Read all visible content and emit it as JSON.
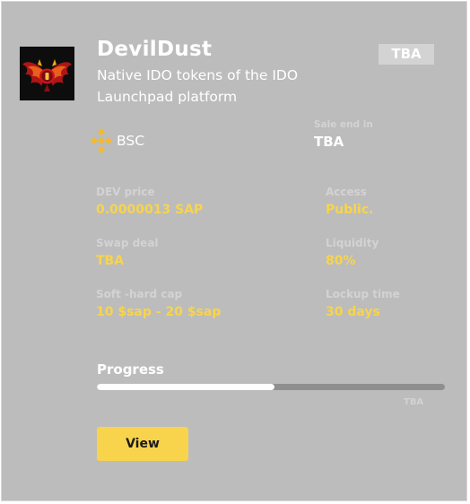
{
  "project": {
    "name": "DevilDust",
    "description": "Native IDO tokens of the IDO Launchpad platform",
    "status_badge": "TBA",
    "logo_icon": "winged-devil-logo"
  },
  "chain": {
    "label": "BSC",
    "icon": "bnb-chain-icon",
    "color": "#f3ba2f"
  },
  "sale_end": {
    "label": "Sale end in",
    "value": "TBA"
  },
  "stats": {
    "dev_price": {
      "label": "DEV price",
      "value": "0.0000013 SAP"
    },
    "access": {
      "label": "Access",
      "value": "Public."
    },
    "swap_deal": {
      "label": "Swap deal",
      "value": "TBA"
    },
    "liquidity": {
      "label": "Liquidity",
      "value": "80%"
    },
    "soft_hard_cap": {
      "label": "Soft -hard cap",
      "value": "10 $sap - 20 $sap"
    },
    "lockup_time": {
      "label": "Lockup time",
      "value": "30 days"
    }
  },
  "progress": {
    "label": "Progress",
    "fraction": 0.51,
    "caption": "TBA"
  },
  "actions": {
    "view_label": "View"
  },
  "colors": {
    "card_bg": "#bcbcbc",
    "accent": "#f8d44c",
    "label_muted": "#d3d3d3",
    "text_primary": "#ffffff"
  }
}
